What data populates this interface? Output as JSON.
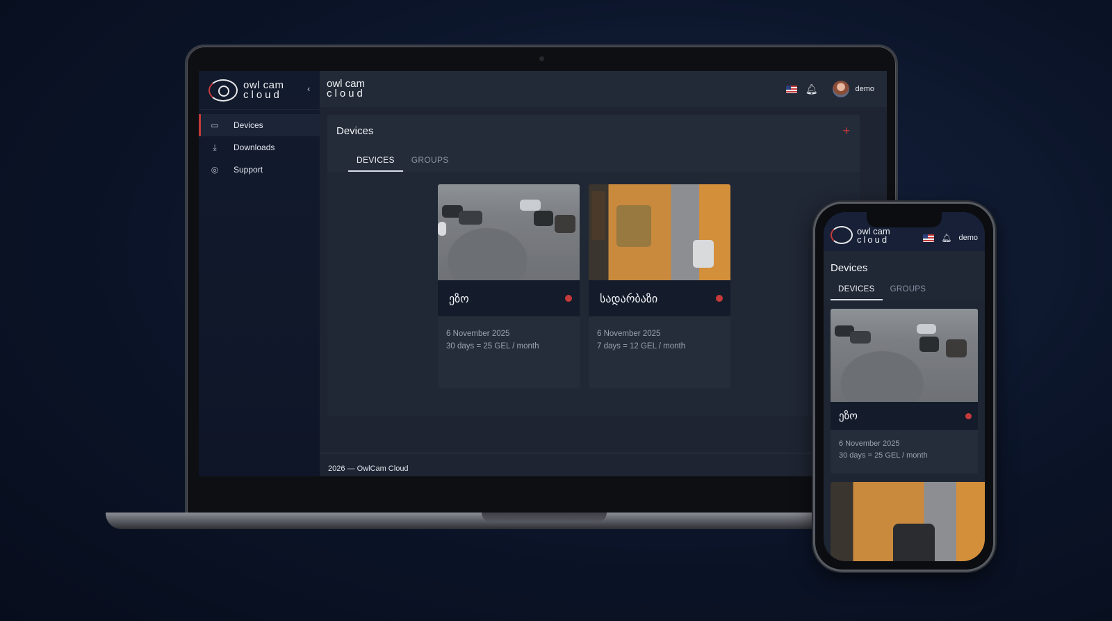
{
  "app": {
    "logo_line1": "owl cam",
    "logo_line2": "cloud",
    "collapse_glyph": "‹"
  },
  "sidebar": {
    "items": [
      {
        "label": "Devices",
        "icon": "camera-icon",
        "active": true
      },
      {
        "label": "Downloads",
        "icon": "download-icon",
        "active": false
      },
      {
        "label": "Support",
        "icon": "support-icon",
        "active": false
      }
    ]
  },
  "header": {
    "language_icon": "us-flag-icon",
    "notification_icon": "bell-icon",
    "username": "demo"
  },
  "main": {
    "title": "Devices",
    "add_glyph": "+",
    "tabs": [
      {
        "label": "DEVICES",
        "active": true
      },
      {
        "label": "GROUPS",
        "active": false
      }
    ],
    "devices": [
      {
        "name": "ეზო",
        "date": "6 November 2025",
        "plan": "30 days = 25 GEL / month",
        "status": "recording"
      },
      {
        "name": "სადარბაზი",
        "date": "6 November 2025",
        "plan": "7 days = 12 GEL / month",
        "status": "recording"
      }
    ]
  },
  "footer": {
    "text": "2026 — OwlCam Cloud"
  },
  "phone": {
    "logo_line1": "owl cam",
    "logo_line2": "cloud",
    "username": "demo",
    "title": "Devices",
    "tabs": [
      {
        "label": "DEVICES",
        "active": true
      },
      {
        "label": "GROUPS",
        "active": false
      }
    ],
    "device": {
      "name": "ეზო",
      "date": "6 November 2025",
      "plan": "30 days = 25 GEL / month"
    }
  },
  "colors": {
    "accent": "#c53a3a",
    "sidebar_bg": "#121a2d",
    "panel_bg": "#252c39"
  }
}
